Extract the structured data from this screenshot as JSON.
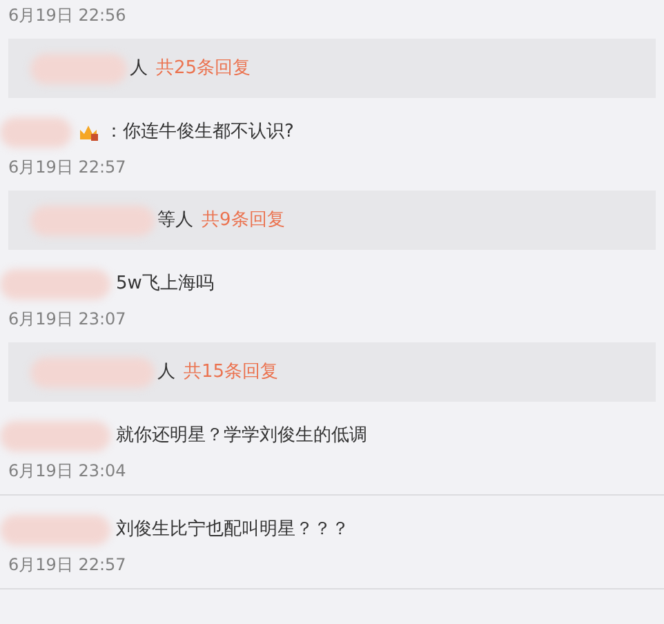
{
  "items": [
    {
      "kind": "time",
      "text": "6月19日 22:56"
    },
    {
      "kind": "replies",
      "name_tail": "人",
      "count": "共25条回复"
    },
    {
      "kind": "comment",
      "badge": true,
      "text": "：你连牛俊生都不认识?"
    },
    {
      "kind": "time",
      "text": "6月19日 22:57"
    },
    {
      "kind": "replies",
      "name_tail": "等人",
      "count": "共9条回复"
    },
    {
      "kind": "comment",
      "badge": false,
      "text": "5w飞上海吗"
    },
    {
      "kind": "time",
      "text": "6月19日 23:07"
    },
    {
      "kind": "replies",
      "name_tail": "人",
      "count": "共15条回复"
    },
    {
      "kind": "comment",
      "badge": false,
      "text": "就你还明星？学学刘俊生的低调"
    },
    {
      "kind": "time",
      "text": "6月19日 23:04"
    },
    {
      "kind": "divider"
    },
    {
      "kind": "comment",
      "badge": false,
      "text": "刘俊生比宁也配叫明星？？？"
    },
    {
      "kind": "time",
      "text": "6月19日 22:57"
    },
    {
      "kind": "divider"
    }
  ]
}
